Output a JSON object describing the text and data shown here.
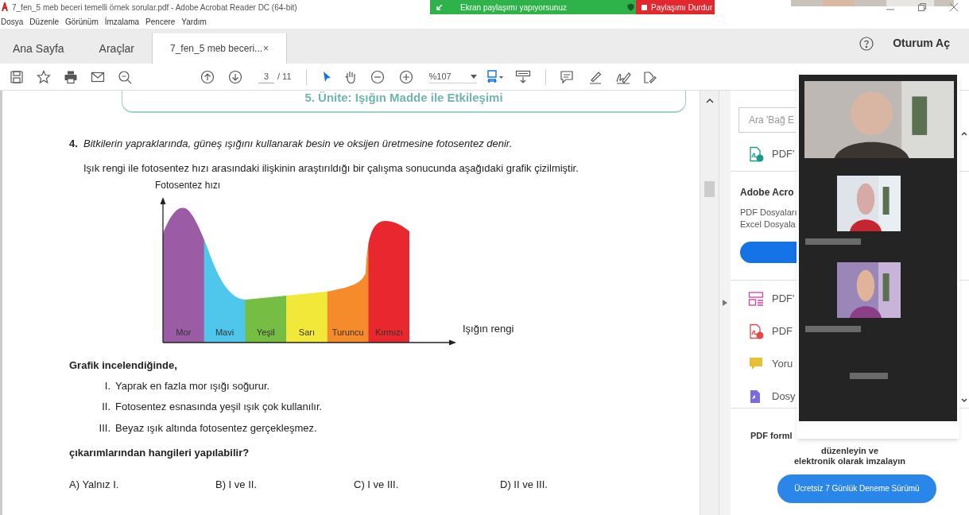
{
  "window": {
    "title": "7_fen_5 meb beceri temelli örnek sorular.pdf - Adobe Acrobat Reader DC (64-bit)"
  },
  "sharing_banner": {
    "status": "Ekran paylaşımı yapıyorsunuz",
    "stop_button": "Paylaşımı Durdur"
  },
  "menu": [
    "Dosya",
    "Düzenle",
    "Görünüm",
    "İmzalama",
    "Pencere",
    "Yardım"
  ],
  "tabs": [
    {
      "label": "Ana Sayfa",
      "kind": "plain",
      "selected": false
    },
    {
      "label": "Araçlar",
      "kind": "plain",
      "selected": false
    },
    {
      "label": "7_fen_5 meb beceri...",
      "kind": "document",
      "close": "×",
      "selected": true
    }
  ],
  "sign_in": "Oturum Aç",
  "toolbar": {
    "page": "3",
    "page_count": "/ 11",
    "zoom": "%107"
  },
  "document": {
    "unit_header": "5. Ünite: Işığın Madde ile Etkileşimi",
    "question_number": "4.",
    "intro": "Bitkilerin yapraklarında, güneş ışığını kullanarak besin ve oksijen üretmesine fotosentez denir.",
    "statement": "Işık rengi ile fotosentez hızı arasındaki ilişkinin araştırıldığı bir çalışma sonucunda aşağıdaki grafik çizilmiştir.",
    "graph": {
      "ylabel": "Fotosentez hızı",
      "xlabel": "Işığın rengi",
      "bands": [
        {
          "label": "Mor",
          "color": "#9b5ba5"
        },
        {
          "label": "Mavi",
          "color": "#4fc6ec"
        },
        {
          "label": "Yeşil",
          "color": "#76bd43"
        },
        {
          "label": "Sarı",
          "color": "#f1e83a"
        },
        {
          "label": "Turuncu",
          "color": "#f68b2c"
        },
        {
          "label": "Kırmızı",
          "color": "#e8282e"
        }
      ]
    },
    "lead": "Grafik incelendiğinde,",
    "statements": [
      {
        "number": "I.",
        "text": "Yaprak en fazla mor ışığı soğurur."
      },
      {
        "number": "II.",
        "text": "Fotosentez esnasında yeşil ışık çok kullanılır."
      },
      {
        "number": "III.",
        "text": "Beyaz ışık altında fotosentez gerçekleşmez."
      }
    ],
    "prompt": "çıkarımlarından hangileri yapılabilir?",
    "options": [
      "A) Yalnız I.",
      "B) I ve II.",
      "C) I ve III.",
      "D) II ve III."
    ]
  },
  "right_panel": {
    "search_placeholder": "Ara 'Bağ E",
    "tools_top": [
      {
        "kind": "export",
        "label": "PDF'"
      }
    ],
    "promo_title": "Adobe Acro",
    "promo_lines": [
      "PDF Dosyaları",
      "Excel Dosyala"
    ],
    "tools": [
      {
        "kind": "organize",
        "label": "PDF'"
      },
      {
        "kind": "create",
        "label": "PDF"
      },
      {
        "kind": "comment",
        "label": "Yoru"
      },
      {
        "kind": "combine",
        "label": "Dosy"
      }
    ],
    "footer_title": "PDF forml",
    "footer_lines": [
      "düzenleyin ve",
      "elektronik olarak imzalayın"
    ],
    "trial_button": "Ücretsiz 7 Günlük Deneme Sürümü"
  }
}
